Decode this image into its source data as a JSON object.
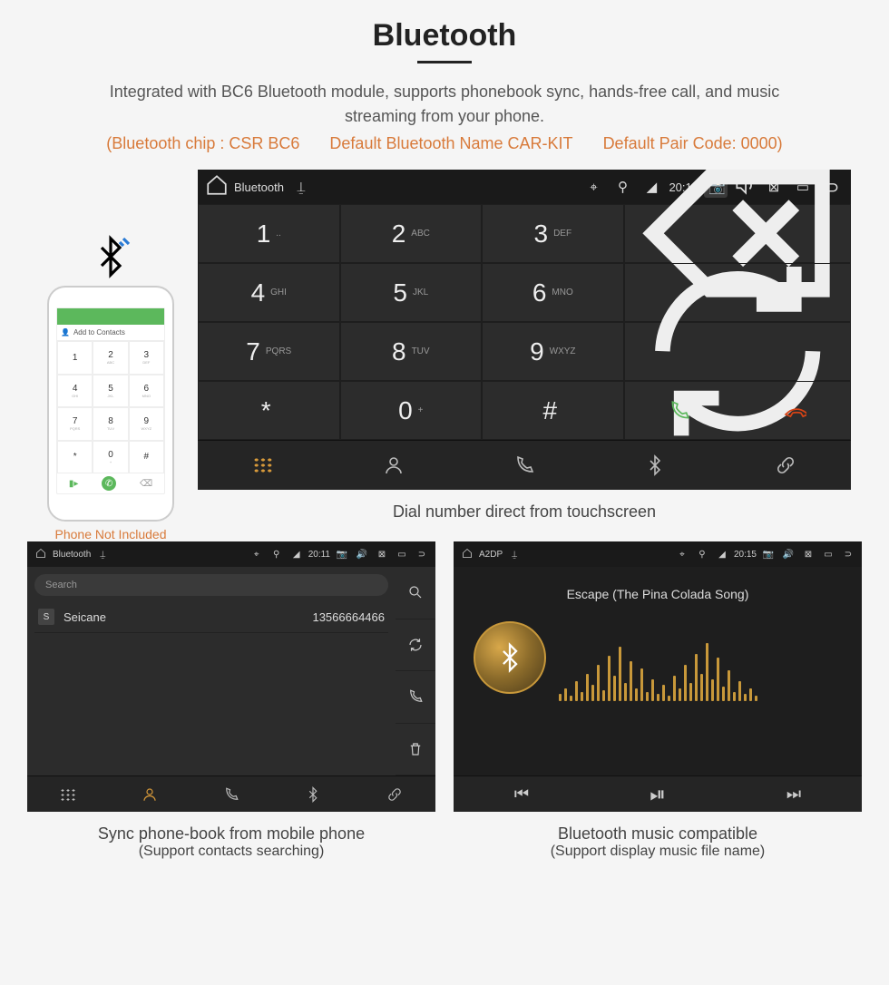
{
  "header": {
    "title": "Bluetooth",
    "description": "Integrated with BC6 Bluetooth module, supports phonebook sync, hands-free call, and music streaming from your phone.",
    "spec_chip": "(Bluetooth chip : CSR BC6",
    "spec_name": "Default Bluetooth Name CAR-KIT",
    "spec_code": "Default Pair Code: 0000)"
  },
  "phone": {
    "add_contacts": "Add to Contacts",
    "not_included": "Phone Not Included",
    "keys": [
      "1",
      "2",
      "3",
      "4",
      "5",
      "6",
      "7",
      "8",
      "9",
      "*",
      "0",
      "#"
    ],
    "letters": [
      "",
      "ABC",
      "DEF",
      "GHI",
      "JKL",
      "MNO",
      "PQRS",
      "TUV",
      "WXYZ",
      "",
      "+",
      ""
    ]
  },
  "dialer": {
    "topbar": {
      "title": "Bluetooth",
      "time": "20:12"
    },
    "keys": [
      {
        "num": "1",
        "let": ".."
      },
      {
        "num": "2",
        "let": "ABC"
      },
      {
        "num": "3",
        "let": "DEF"
      },
      {
        "num": "4",
        "let": "GHI"
      },
      {
        "num": "5",
        "let": "JKL"
      },
      {
        "num": "6",
        "let": "MNO"
      },
      {
        "num": "7",
        "let": "PQRS"
      },
      {
        "num": "8",
        "let": "TUV"
      },
      {
        "num": "9",
        "let": "WXYZ"
      },
      {
        "num": "*",
        "let": ""
      },
      {
        "num": "0",
        "let": "+"
      },
      {
        "num": "#",
        "let": ""
      }
    ],
    "caption": "Dial number direct from touchscreen"
  },
  "phonebook": {
    "topbar": {
      "title": "Bluetooth",
      "time": "20:11"
    },
    "search_placeholder": "Search",
    "contact_name": "Seicane",
    "contact_number": "13566664466",
    "contact_badge": "S",
    "caption": "Sync phone-book from mobile phone",
    "caption2": "(Support contacts searching)"
  },
  "music": {
    "topbar": {
      "title": "A2DP",
      "time": "20:15"
    },
    "song": "Escape (The Pina Colada Song)",
    "caption": "Bluetooth music compatible",
    "caption2": "(Support display music file name)"
  },
  "viz_heights": [
    8,
    14,
    6,
    22,
    10,
    30,
    18,
    40,
    12,
    50,
    28,
    60,
    20,
    44,
    14,
    36,
    10,
    24,
    8,
    18,
    6,
    28,
    14,
    40,
    20,
    52,
    30,
    64,
    24,
    48,
    16,
    34,
    10,
    22,
    8,
    14,
    6
  ]
}
